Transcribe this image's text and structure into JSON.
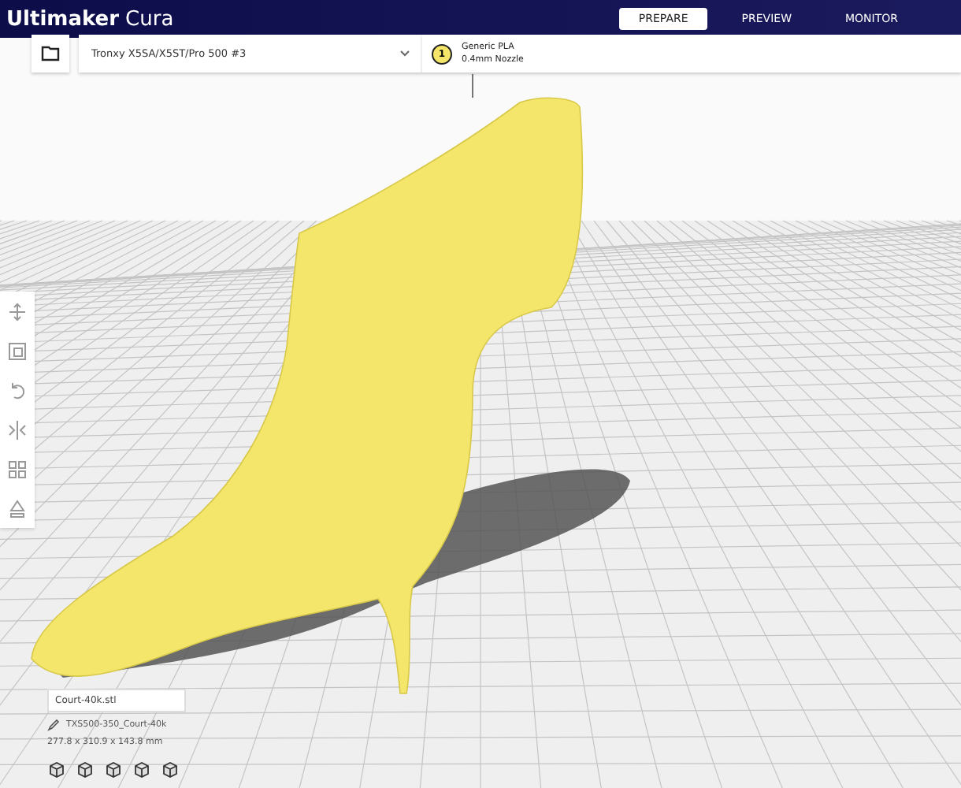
{
  "app": {
    "brand": "Ultimaker",
    "product": "Cura"
  },
  "tabs": [
    {
      "label": "PREPARE",
      "selected": true
    },
    {
      "label": "PREVIEW",
      "selected": false
    },
    {
      "label": "MONITOR",
      "selected": false
    }
  ],
  "printer": {
    "name": "Tronxy X5SA/X5ST/Pro 500 #3"
  },
  "extruder": {
    "number": "1",
    "material": "Generic PLA",
    "nozzle": "0.4mm Nozzle"
  },
  "object_list": {
    "file": "Court-40k.stl",
    "object_name": "TXS500-350_Court-40k",
    "dimensions": "277.8 x 310.9 x 143.8 mm"
  }
}
